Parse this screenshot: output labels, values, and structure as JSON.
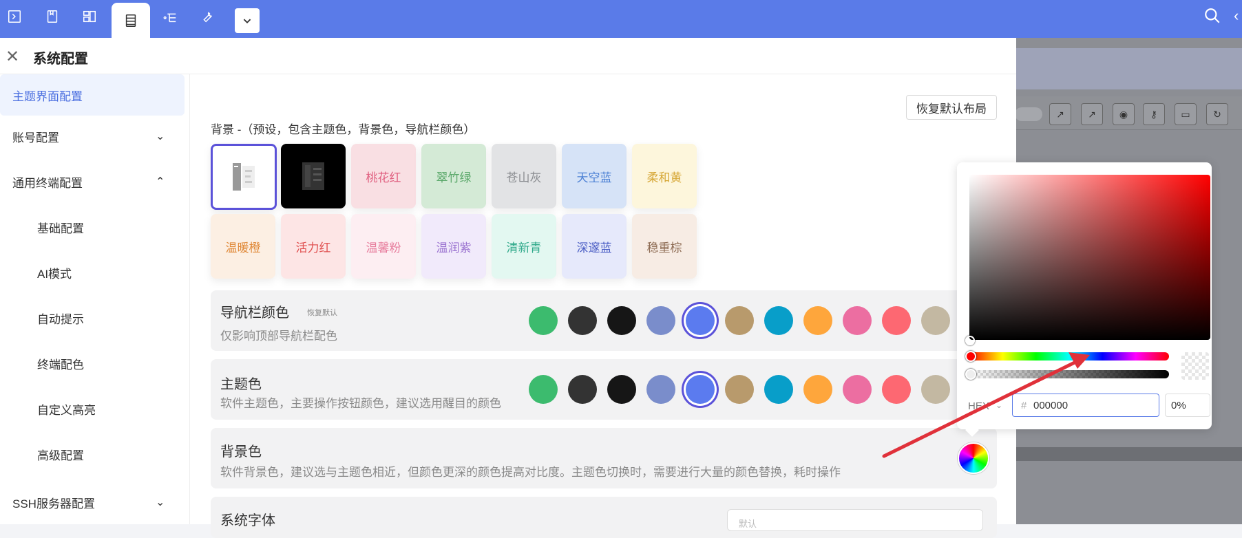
{
  "topbar": {
    "icons": [
      "terminal-icon",
      "bookmark-icon",
      "layout-icon",
      "server-icon",
      "share-icon",
      "wrench-icon",
      "chevron-down-icon"
    ]
  },
  "drawer": {
    "title": "系统配置"
  },
  "sidebar": {
    "items": [
      {
        "label": "主题界面配置"
      },
      {
        "label": "账号配置"
      },
      {
        "label": "通用终端配置"
      },
      {
        "label": "基础配置"
      },
      {
        "label": "AI模式"
      },
      {
        "label": "自动提示"
      },
      {
        "label": "终端配色"
      },
      {
        "label": "自定义高亮"
      },
      {
        "label": "高级配置"
      },
      {
        "label": "SSH服务器配置"
      }
    ]
  },
  "theme": {
    "reset_layout": "恢复默认布局",
    "background_label": "背景 -（预设，包含主题色，背景色，导航栏颜色）",
    "presets_row1": [
      {
        "label": "",
        "bg": "#ffffff"
      },
      {
        "label": "",
        "bg": "#000000"
      },
      {
        "label": "桃花红",
        "bg": "#f9dfe3",
        "color": "#e06080"
      },
      {
        "label": "翠竹绿",
        "bg": "#d4ead6",
        "color": "#5aa86a"
      },
      {
        "label": "苍山灰",
        "bg": "#e2e3e5",
        "color": "#8a8c90"
      },
      {
        "label": "天空蓝",
        "bg": "#d6e3f7",
        "color": "#4a7fd4"
      },
      {
        "label": "柔和黄",
        "bg": "#fdf6dc",
        "color": "#d6a736"
      }
    ],
    "presets_row2": [
      {
        "label": "温暖橙",
        "bg": "#fcefe3",
        "color": "#e08a3a"
      },
      {
        "label": "活力红",
        "bg": "#fde5e5",
        "color": "#e05050"
      },
      {
        "label": "温馨粉",
        "bg": "#fdeef2",
        "color": "#e77d9d"
      },
      {
        "label": "温润紫",
        "bg": "#f1eafb",
        "color": "#9a72d0"
      },
      {
        "label": "清新青",
        "bg": "#e3f8f1",
        "color": "#2fa98a"
      },
      {
        "label": "深邃蓝",
        "bg": "#e6e9fb",
        "color": "#4a5dc4"
      },
      {
        "label": "稳重棕",
        "bg": "#f7ece4",
        "color": "#8c6a52"
      }
    ],
    "nav_color": {
      "title": "导航栏颜色",
      "restore": "恢复默认",
      "desc": "仅影响顶部导航栏配色"
    },
    "main_color": {
      "title": "主题色",
      "desc": "软件主题色，主要操作按钮颜色，建议选用醒目的颜色"
    },
    "bg_color": {
      "title": "背景色",
      "desc": "软件背景色，建议选与主题色相近，但颜色更深的颜色提高对比度。主题色切换时，需要进行大量的颜色替换，耗时操作"
    },
    "font": {
      "title": "系统字体",
      "placeholder": "默认"
    },
    "palette": [
      "#3cbb6e",
      "#333333",
      "#161616",
      "#7a8dcb",
      "#5b7bef",
      "#b89a6c",
      "#089ec9",
      "#fea63c",
      "#ec6ea1",
      "#fd6872",
      "#c3b8a2"
    ],
    "selected_index": 4
  },
  "picker": {
    "hex_label": "HEX",
    "hex_value": "000000",
    "alpha": "0%"
  }
}
